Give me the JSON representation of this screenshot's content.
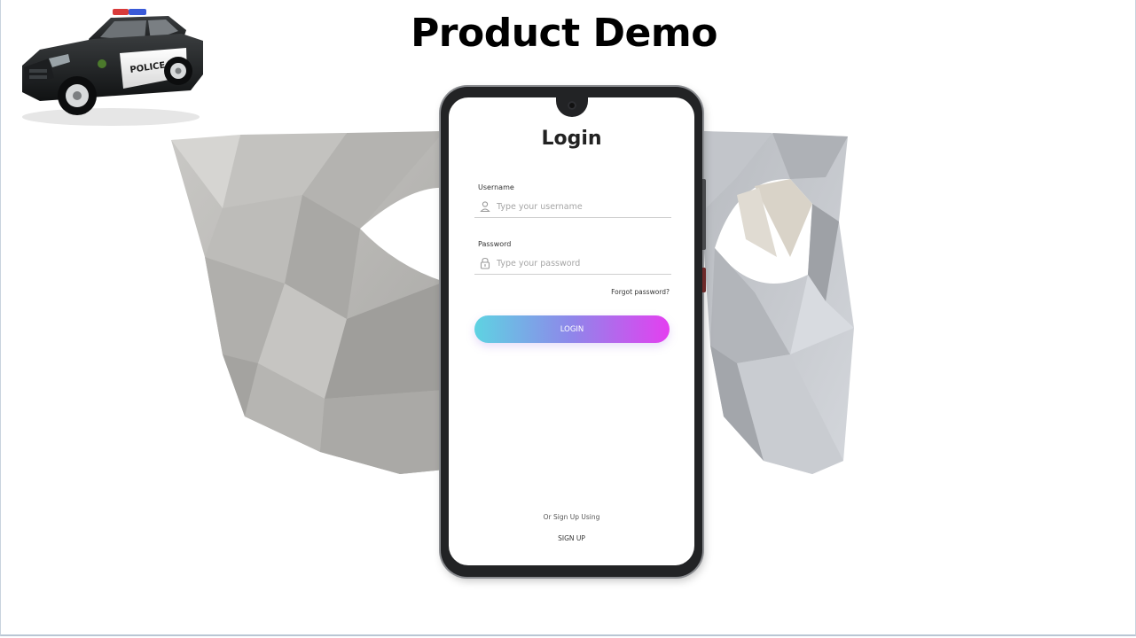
{
  "slide": {
    "title": "Product Demo"
  },
  "decor": {
    "car_icon": "police-car-icon",
    "car_text": "POLICE",
    "model_icon": "face-mask-3d-model"
  },
  "login": {
    "title": "Login",
    "username_label": "Username",
    "username_placeholder": "Type your username",
    "password_label": "Password",
    "password_placeholder": "Type your password",
    "forgot_label": "Forgot password?",
    "button_label": "LOGIN",
    "signup_hint": "Or Sign Up Using",
    "signup_label": "SIGN UP",
    "button_gradient": [
      "#5ed3e2",
      "#8f86ea",
      "#e43ff0"
    ]
  }
}
